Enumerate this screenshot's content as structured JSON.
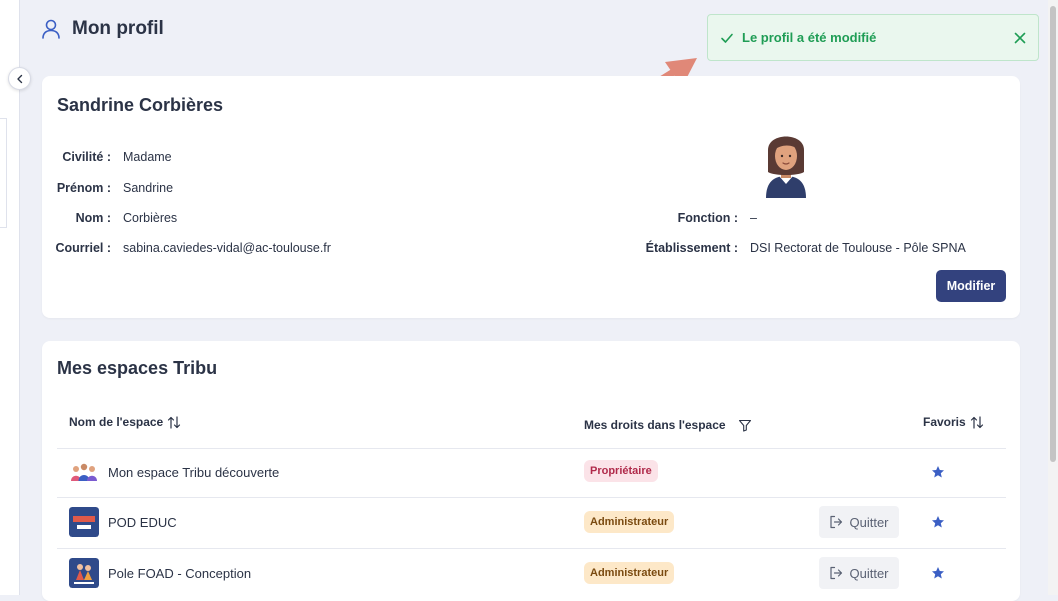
{
  "page": {
    "title": "Mon profil"
  },
  "toast": {
    "message": "Le profil a été modifié"
  },
  "profile": {
    "name": "Sandrine Corbières",
    "fields": {
      "civilite": {
        "label": "Civilité :",
        "value": "Madame"
      },
      "prenom": {
        "label": "Prénom :",
        "value": "Sandrine"
      },
      "nom": {
        "label": "Nom :",
        "value": "Corbières"
      },
      "courriel": {
        "label": "Courriel :",
        "value": "sabina.caviedes-vidal@ac-toulouse.fr"
      },
      "fonction": {
        "label": "Fonction :",
        "value": "–"
      },
      "etablissement": {
        "label": "Établissement :",
        "value": "DSI Rectorat de Toulouse - Pôle SPNA"
      }
    },
    "edit_label": "Modifier"
  },
  "spaces": {
    "title": "Mes espaces Tribu",
    "columns": {
      "name": "Nom de l'espace",
      "rights": "Mes droits dans l'espace",
      "favorites": "Favoris"
    },
    "rows": [
      {
        "name": "Mon espace Tribu découverte",
        "role": "Propriétaire",
        "quit_label": "",
        "icon": "people-group-icon"
      },
      {
        "name": "POD EDUC",
        "role": "Administrateur",
        "quit_label": "Quitter",
        "icon": "pod-educ-icon"
      },
      {
        "name": "Pole FOAD - Conception",
        "role": "Administrateur",
        "quit_label": "Quitter",
        "icon": "foad-conception-icon"
      }
    ]
  },
  "colors": {
    "primary": "#33427e",
    "success": "#1f9d55",
    "star": "#3b5fc4",
    "arrow": "#e08878"
  }
}
